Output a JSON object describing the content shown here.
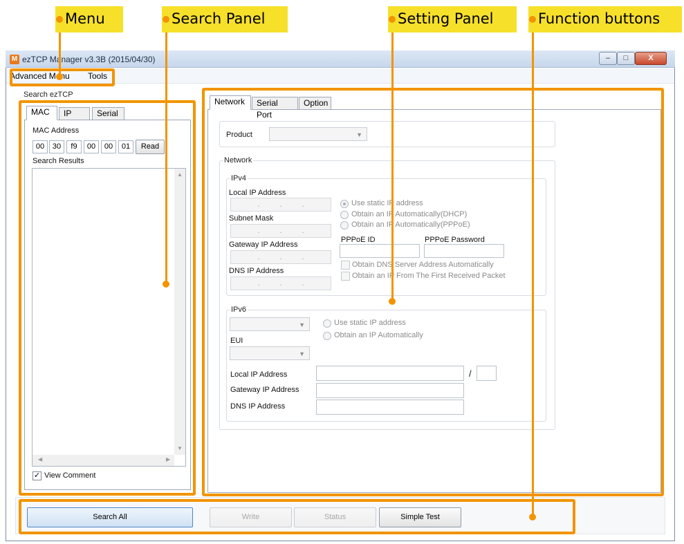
{
  "callouts": {
    "menu": "Menu",
    "search_panel": "Search Panel",
    "setting_panel": "Setting Panel",
    "function_buttons": "Function buttons"
  },
  "window": {
    "title": "ezTCP Manager v3.3B (2015/04/30)",
    "app_icon": "M",
    "controls": {
      "minimize": "–",
      "maximize": "□",
      "close": "X"
    }
  },
  "menubar": {
    "items": [
      "Advanced Menu",
      "Tools"
    ]
  },
  "search": {
    "group_title": "Search ezTCP",
    "tabs": [
      "MAC",
      "IP",
      "Serial"
    ],
    "mac_label": "MAC Address",
    "mac_octets": [
      "00",
      "30",
      "f9",
      "00",
      "00",
      "01"
    ],
    "read_button": "Read",
    "results_label": "Search Results",
    "view_comment_label": "View Comment",
    "view_comment_checked": true
  },
  "settings": {
    "tabs": [
      "Network",
      "Serial Port",
      "Option"
    ],
    "product_label": "Product",
    "product_value": "",
    "network_legend": "Network",
    "ipv4": {
      "legend": "IPv4",
      "local_ip_label": "Local IP Address",
      "subnet_label": "Subnet Mask",
      "gateway_label": "Gateway IP Address",
      "dns_label": "DNS IP Address",
      "ip_placeholder_dots": [
        ".",
        ".",
        "."
      ],
      "radio_options": [
        "Use static IP address",
        "Obtain an IP Automatically(DHCP)",
        "Obtain an IP Automatically(PPPoE)"
      ],
      "pppoe_id_label": "PPPoE ID",
      "pppoe_password_label": "PPPoE Password",
      "obtain_dns_label": "Obtain DNS Server Address Automatically",
      "obtain_ip_packet_label": "Obtain an IP From The First Received Packet"
    },
    "ipv6": {
      "legend": "IPv6",
      "radio_options": [
        "Use static IP address",
        "Obtain an IP Automatically"
      ],
      "eui_label": "EUI",
      "local_ip_label": "Local IP Address",
      "prefix_separator": "/",
      "gateway_label": "Gateway IP Address",
      "dns_label": "DNS IP Address"
    }
  },
  "function_buttons": {
    "search_all": "Search All",
    "write": "Write",
    "status": "Status",
    "simple_test": "Simple Test"
  },
  "colors": {
    "callout_bg": "#f7e02a",
    "highlight_orange": "#f29400",
    "window_border": "#7a8fa8"
  }
}
